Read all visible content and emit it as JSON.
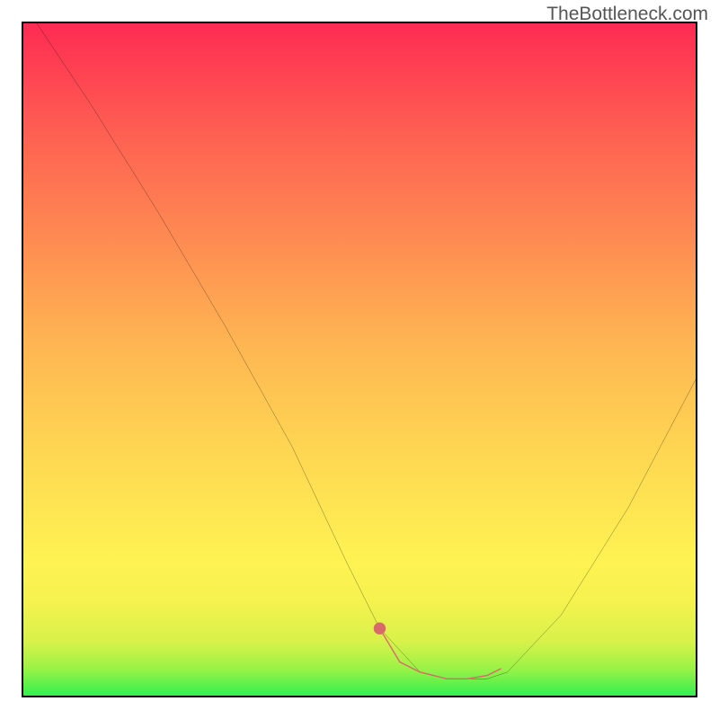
{
  "watermark": "TheBottleneck.com",
  "chart_data": {
    "type": "line",
    "title": "",
    "xlabel": "",
    "ylabel": "",
    "xlim": [
      0,
      100
    ],
    "ylim": [
      0,
      100
    ],
    "series": [
      {
        "name": "curve",
        "color": "#000000",
        "x": [
          2,
          10,
          20,
          30,
          40,
          48,
          53,
          59,
          63,
          69,
          72,
          80,
          90,
          100
        ],
        "y": [
          100,
          88,
          72,
          55,
          37,
          20,
          10,
          3.5,
          2.5,
          2.5,
          3.5,
          12,
          28,
          47
        ]
      },
      {
        "name": "highlight",
        "color": "#d86a6a",
        "x": [
          53,
          56,
          59,
          63,
          66,
          69,
          71
        ],
        "y": [
          10,
          5,
          3.5,
          2.5,
          2.5,
          3,
          4
        ]
      }
    ],
    "gradient_stops": [
      {
        "pos": 0,
        "color": "#34f04e"
      },
      {
        "pos": 0.5,
        "color": "#fec752"
      },
      {
        "pos": 1,
        "color": "#fe2b52"
      }
    ]
  }
}
